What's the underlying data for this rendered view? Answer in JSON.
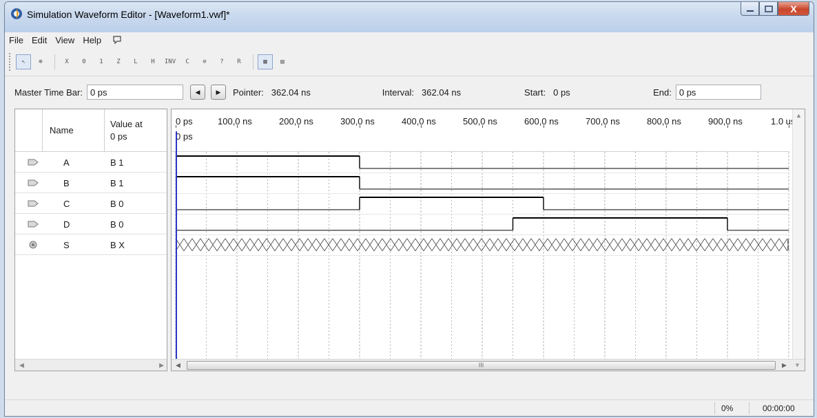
{
  "window": {
    "title": "Simulation Waveform Editor - [Waveform1.vwf]*",
    "min_icon": "minimize-icon",
    "max_icon": "maximize-icon",
    "close_icon": "close-icon",
    "close_glyph": "X"
  },
  "menu": [
    "File",
    "Edit",
    "View",
    "Help"
  ],
  "menu_extra_icon": "feedback-icon",
  "toolbar": {
    "tools": [
      {
        "name": "pointer-tool-icon",
        "glyph": "↖",
        "pressed": true
      },
      {
        "name": "zoom-tool-icon",
        "glyph": "⊕"
      },
      {
        "name": "forcing-unknown-icon",
        "glyph": "X"
      },
      {
        "name": "forcing-low-icon",
        "glyph": "0"
      },
      {
        "name": "forcing-high-icon",
        "glyph": "1"
      },
      {
        "name": "high-impedance-icon",
        "glyph": "Z"
      },
      {
        "name": "weak-low-icon",
        "glyph": "L"
      },
      {
        "name": "weak-high-icon",
        "glyph": "H"
      },
      {
        "name": "invert-icon",
        "glyph": "INV"
      },
      {
        "name": "count-value-icon",
        "glyph": "C"
      },
      {
        "name": "overwrite-clock-icon",
        "glyph": "⊘"
      },
      {
        "name": "arbitrary-value-icon",
        "glyph": "?"
      },
      {
        "name": "random-values-icon",
        "glyph": "R"
      },
      {
        "name": "snap-to-grid-icon",
        "glyph": "▦",
        "pressed": true
      },
      {
        "name": "sort-icon",
        "glyph": "▤"
      }
    ]
  },
  "timebar": {
    "master_label": "Master Time Bar:",
    "master_value": "0 ps",
    "prev_icon": "arrow-left-icon",
    "next_icon": "arrow-right-icon",
    "pointer_label": "Pointer:",
    "pointer_value": "362.04 ns",
    "interval_label": "Interval:",
    "interval_value": "362.04 ns",
    "start_label": "Start:",
    "start_value": "0 ps",
    "end_label": "End:",
    "end_value": "0 ps"
  },
  "signal_table": {
    "name_header": "Name",
    "value_header_line1": "Value at",
    "value_header_line2": "0 ps",
    "signals": [
      {
        "name": "A",
        "value": "B 1",
        "icon": "input-pin-icon"
      },
      {
        "name": "B",
        "value": "B 1",
        "icon": "input-pin-icon"
      },
      {
        "name": "C",
        "value": "B 0",
        "icon": "input-pin-icon"
      },
      {
        "name": "D",
        "value": "B 0",
        "icon": "input-pin-icon"
      },
      {
        "name": "S",
        "value": "B X",
        "icon": "output-pin-icon"
      }
    ]
  },
  "ruler": {
    "labels": [
      "0 ps",
      "100,0 ns",
      "200,0 ns",
      "300,0 ns",
      "400,0 ns",
      "500,0 ns",
      "600,0 ns",
      "700,0 ns",
      "800,0 ns",
      "900,0 ns",
      "1.0 us"
    ],
    "marker_label": "0 ps"
  },
  "waveforms": {
    "time_unit": "ns",
    "time_range": [
      0,
      1000
    ],
    "signals": [
      {
        "name": "A",
        "segments": [
          {
            "from": 0,
            "to": 300,
            "level": "1"
          },
          {
            "from": 300,
            "to": 1000,
            "level": "0"
          }
        ]
      },
      {
        "name": "B",
        "segments": [
          {
            "from": 0,
            "to": 300,
            "level": "1"
          },
          {
            "from": 300,
            "to": 1000,
            "level": "0"
          }
        ]
      },
      {
        "name": "C",
        "segments": [
          {
            "from": 0,
            "to": 300,
            "level": "0"
          },
          {
            "from": 300,
            "to": 600,
            "level": "1"
          },
          {
            "from": 600,
            "to": 1000,
            "level": "0"
          }
        ]
      },
      {
        "name": "D",
        "segments": [
          {
            "from": 0,
            "to": 550,
            "level": "0"
          },
          {
            "from": 550,
            "to": 900,
            "level": "1"
          },
          {
            "from": 900,
            "to": 1000,
            "level": "0"
          }
        ]
      },
      {
        "name": "S",
        "segments": [
          {
            "from": 0,
            "to": 1000,
            "level": "X"
          }
        ]
      }
    ]
  },
  "scroll": {
    "left_arrow": "◀",
    "right_arrow": "▶",
    "up_arrow": "▲",
    "down_arrow": "▼",
    "thumb_grip": "III"
  },
  "status": {
    "progress": "0%",
    "elapsed": "00:00:00"
  },
  "colors": {
    "cursor": "#2a36c8",
    "wave": "#000000",
    "grid": "#b4b4b4",
    "close_button": "#c9462c"
  }
}
